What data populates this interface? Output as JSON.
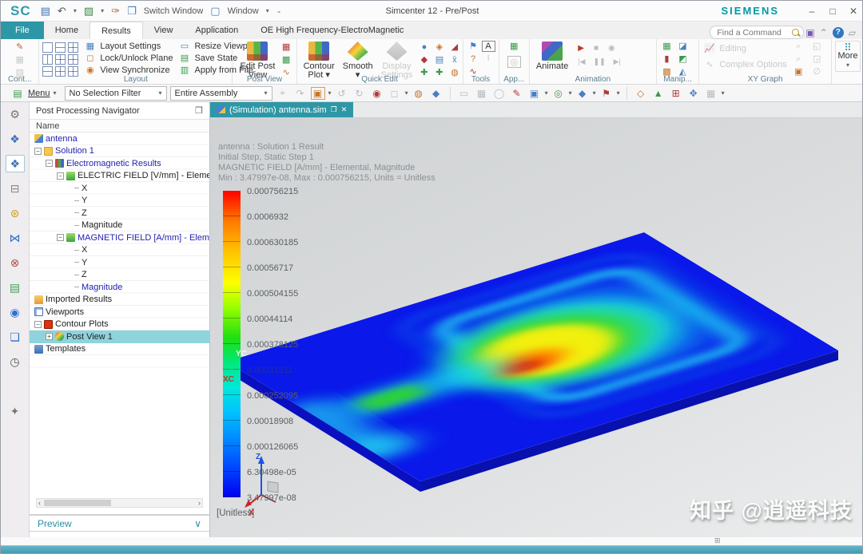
{
  "window": {
    "app_initials": "SC",
    "title": "Simcenter 12 - Pre/Post",
    "brand": "SIEMENS",
    "controls": {
      "minimize": "–",
      "maximize": "□",
      "close": "✕"
    }
  },
  "titlebar": {
    "switch_window": "Switch Window",
    "window_menu": "Window"
  },
  "icons": {
    "save": "▤",
    "undo": "↶",
    "repeat_command": "▨",
    "touch_mode": "✑",
    "switch_window": "❐",
    "window": "▢",
    "qat_customize": "⌄",
    "ribbon_window": "▣",
    "collapse_ribbon": "⌃",
    "help": "?",
    "doc": "▱",
    "gtab_restore": "❐",
    "gtab_close": "✕",
    "panel_float": "❐",
    "scroll_left": "‹",
    "scroll_right": "›",
    "preview_chevron": "∨",
    "status_grid": "⊞"
  },
  "tabs": {
    "items": [
      "File",
      "Home",
      "Results",
      "View",
      "Application",
      "OE High Frequency-ElectroMagnetic"
    ],
    "active": "Results",
    "find_placeholder": "Find a Command"
  },
  "ribbon": {
    "cont": {
      "label": "Cont...",
      "icons": [
        "✎",
        "▦",
        "▧"
      ]
    },
    "layout": {
      "label": "Layout",
      "buttons": [
        "Layout Settings",
        "Lock/Unlock Plane",
        "View Synchronize",
        "Resize Viewport",
        "Save State",
        "Apply from File"
      ],
      "button_icons": [
        "▦",
        "◻",
        "◉",
        "▭",
        "▤",
        "▥"
      ]
    },
    "post_view": {
      "label": "Post View",
      "edit_post_view": "Edit Post View",
      "small_icons": [
        "▦",
        "▩",
        "∿"
      ]
    },
    "quick_edit": {
      "label": "Quick Edit",
      "contour_plot": "Contour Plot",
      "smooth": "Smooth",
      "display_settings": "Display Settings",
      "small_icons": [
        "●",
        "◈",
        "◢",
        "◆",
        "▤",
        "x̄",
        "✚",
        "✚",
        "◍"
      ]
    },
    "tools": {
      "label": "Tools",
      "icons": [
        "⚑",
        "?",
        "A",
        "∿",
        "Ι"
      ]
    },
    "app": {
      "label": "App...",
      "icons": [
        "▦",
        "◎"
      ]
    },
    "animation": {
      "label": "Animation",
      "animate": "Animate",
      "transport": [
        "▶",
        "■",
        "◉"
      ],
      "stepper": [
        "|◀",
        "❚❚",
        "▶|"
      ]
    },
    "manip": {
      "label": "Manip...",
      "icons": [
        "▦",
        "◪",
        "▮",
        "◩",
        "▩",
        "◭"
      ]
    },
    "xy_graph": {
      "label": "XY Graph",
      "editing": "Editing",
      "complex_options": "Complex Options",
      "icons": [
        "⌕",
        "⌕",
        "◱",
        "◲",
        "▣",
        "∅"
      ]
    },
    "more": {
      "label": "More",
      "icon": "⠿"
    }
  },
  "selection_bar": {
    "menu": "Menu",
    "selection_filter": "No Selection Filter",
    "scope": "Entire Assembly",
    "icons": [
      {
        "name": "snap-point-icon",
        "g": "⌖"
      },
      {
        "name": "move-object-icon",
        "g": "↷"
      },
      {
        "name": "select-box-icon",
        "g": "▣"
      },
      {
        "name": "rotate-ccw-icon",
        "g": "↺"
      },
      {
        "name": "rotate-cw-icon",
        "g": "↻"
      },
      {
        "name": "magnet-icon",
        "g": "◉"
      },
      {
        "name": "marquee-select-icon",
        "g": "◻"
      },
      {
        "name": "render-style-icon",
        "g": "◍"
      },
      {
        "name": "shaded-view-icon",
        "g": "◆"
      },
      {
        "name": "window-icon",
        "g": "▭"
      },
      {
        "name": "image-icon",
        "g": "▦"
      },
      {
        "name": "orbit-icon",
        "g": "◯"
      },
      {
        "name": "brush-icon",
        "g": "✎"
      },
      {
        "name": "header-icon",
        "g": "▣"
      },
      {
        "name": "sphere-icon",
        "g": "◎"
      },
      {
        "name": "cube-icon",
        "g": "◆"
      },
      {
        "name": "flag-icon",
        "g": "⚑"
      },
      {
        "name": "datum-icon",
        "g": "◇"
      },
      {
        "name": "terrain-icon",
        "g": "▲"
      },
      {
        "name": "grid-icon",
        "g": "⊞"
      },
      {
        "name": "expand-icon",
        "g": "✥"
      },
      {
        "name": "table-icon",
        "g": "▦"
      }
    ]
  },
  "sidebar": {
    "items": [
      {
        "name": "settings-gear-icon",
        "g": "⚙"
      },
      {
        "name": "assembly-navigator-icon",
        "g": "❖"
      },
      {
        "name": "post-processing-navigator-icon",
        "g": "❖",
        "selected": true
      },
      {
        "name": "constraint-navigator-icon",
        "g": "⊟"
      },
      {
        "name": "parts-navigator-icon",
        "g": "⊛"
      },
      {
        "name": "motion-navigator-icon",
        "g": "⋈"
      },
      {
        "name": "connection-navigator-icon",
        "g": "⊗"
      },
      {
        "name": "history-icon",
        "g": "▤"
      },
      {
        "name": "internet-info-icon",
        "g": "◉"
      },
      {
        "name": "notes-icon",
        "g": "❏"
      },
      {
        "name": "journal-clock-icon",
        "g": "◷"
      },
      {
        "name": "color-bar-icon",
        "g": ""
      },
      {
        "name": "manipulate-icon",
        "g": "✦"
      }
    ]
  },
  "navigator": {
    "title": "Post Processing Navigator",
    "column": "Name",
    "preview": "Preview",
    "tree": [
      {
        "label": "antenna"
      },
      {
        "label": "Solution 1",
        "expander": "−"
      },
      {
        "label": "Electromagnetic Results",
        "expander": "−"
      },
      {
        "label": "ELECTRIC FIELD [V/mm] - Elemental",
        "expander": "−"
      },
      {
        "label": "X"
      },
      {
        "label": "Y"
      },
      {
        "label": "Z"
      },
      {
        "label": "Magnitude"
      },
      {
        "label": "MAGNETIC FIELD [A/mm] - Elemental",
        "expander": "−"
      },
      {
        "label": "X"
      },
      {
        "label": "Y"
      },
      {
        "label": "Z"
      },
      {
        "label": "Magnitude"
      },
      {
        "label": "Imported Results"
      },
      {
        "label": "Viewports"
      },
      {
        "label": "Contour Plots",
        "expander": "−"
      },
      {
        "label": "Post View 1",
        "expander": "+"
      },
      {
        "label": "Templates"
      }
    ]
  },
  "viewport": {
    "tab": "(Simulation) antenna.sim",
    "annotation": [
      "antenna : Solution 1 Result",
      "Initial Step, Static Step 1",
      "MAGNETIC FIELD [A/mm] - Elemental, Magnitude",
      "Min : 3.47997e-08, Max : 0.000756215, Units = Unitless"
    ],
    "legend": {
      "labels": [
        "0.000756215",
        "0.0006932",
        "0.000630185",
        "0.00056717",
        "0.000504155",
        "0.00044114",
        "0.000378125",
        "0.00031511",
        "0.000252095",
        "0.00018908",
        "0.000126065",
        "6.30498e-05",
        "3.47997e-08"
      ],
      "unit": "[Unitless]",
      "top_color": "#ff0000",
      "bottom_color": "#0000f0"
    },
    "axes": {
      "z": "Z",
      "x": "X",
      "y": "Y",
      "xc": "XC",
      "yc": "YC"
    },
    "watermark": "知乎 @逍遥科技"
  },
  "colors": {
    "accent_teal": "#2e97a6",
    "selection_highlight": "#8fd3dd",
    "tree_link_blue": "#2222b0",
    "bottom_bar": "#3b93a9"
  }
}
